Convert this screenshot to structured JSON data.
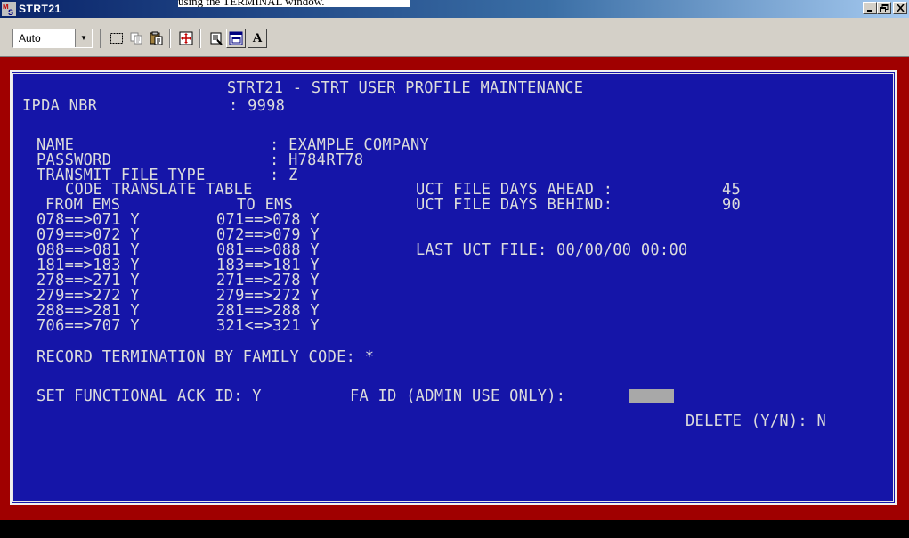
{
  "window": {
    "title": "STRT21",
    "annotation": "using the TERMINAL window."
  },
  "toolbar": {
    "font_select": {
      "value": "Auto"
    },
    "icons": [
      "select-all-icon",
      "copy-icon",
      "paste-icon",
      "fullscreen-icon",
      "properties-icon",
      "background-icon",
      "font-icon"
    ]
  },
  "screen": {
    "header": "STRT21 - STRT USER PROFILE MAINTENANCE",
    "ipda_label": "IPDA NBR",
    "ipda_value": ": 9998",
    "name_label": "NAME",
    "name_value": ": EXAMPLE COMPANY",
    "password_label": "PASSWORD",
    "password_value": ": H784RT78",
    "file_type_label": "TRANSMIT FILE TYPE",
    "file_type_value": ": Z",
    "code_table_title": "CODE TRANSLATE TABLE",
    "from_ems_label": "FROM EMS",
    "to_ems_label": "TO EMS",
    "from_ems": [
      "078==>071 Y",
      "079==>072 Y",
      "088==>081 Y",
      "181==>183 Y",
      "278==>271 Y",
      "279==>272 Y",
      "288==>281 Y",
      "706==>707 Y"
    ],
    "to_ems": [
      "071==>078 Y",
      "072==>079 Y",
      "081==>088 Y",
      "183==>181 Y",
      "271==>278 Y",
      "279==>272 Y",
      "281==>288 Y",
      "321<=>321 Y"
    ],
    "uct_ahead_label": "UCT FILE DAYS AHEAD :",
    "uct_ahead_value": "45",
    "uct_behind_label": "UCT FILE DAYS BEHIND:",
    "uct_behind_value": "90",
    "last_uct_label": "LAST UCT FILE: 00/00/00 00:00",
    "record_term": "RECORD TERMINATION BY FAMILY CODE: *",
    "func_ack": "SET FUNCTIONAL ACK ID: Y",
    "fa_id_label": "FA ID (ADMIN USE ONLY):",
    "delete_label": "DELETE (Y/N): N"
  },
  "colors": {
    "screen_bg": "#1515a8",
    "frame": "#a00000",
    "text": "#dcdcdc"
  }
}
